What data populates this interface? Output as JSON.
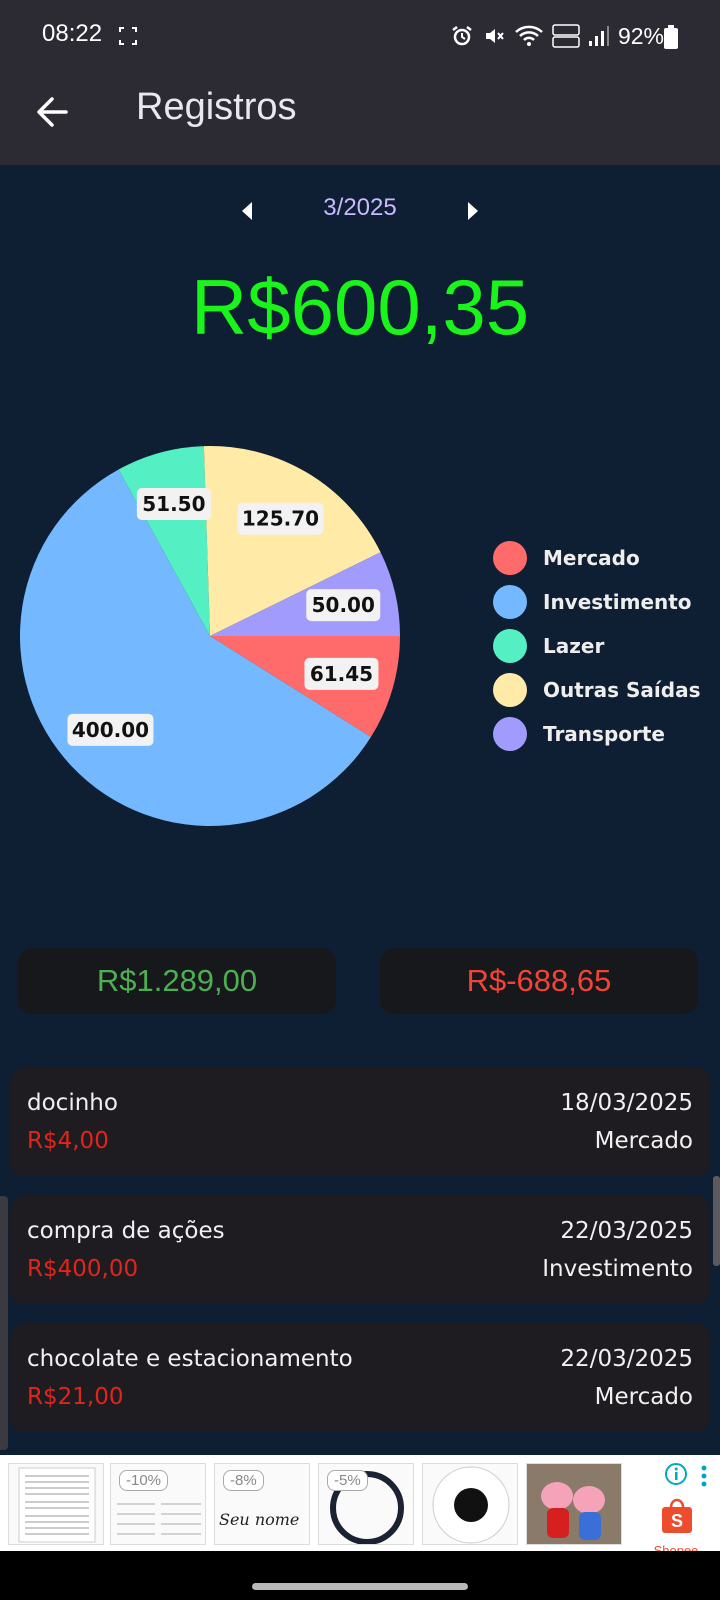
{
  "status_bar": {
    "time": "08:22",
    "battery_text": "92%",
    "icons": [
      "alarm-icon",
      "mute-icon",
      "wifi-icon",
      "volte-icon",
      "signal-icon",
      "battery-icon"
    ]
  },
  "app_bar": {
    "title": "Registros",
    "back_icon": "arrow-left-icon"
  },
  "month_nav": {
    "label": "3/2025",
    "prev_icon": "caret-left-icon",
    "next_icon": "caret-right-icon"
  },
  "balance": "R$600,35",
  "chart_data": {
    "type": "pie",
    "slices": [
      {
        "name": "Mercado",
        "value": 61.45,
        "label": "61.45",
        "color": "#ff6b6b"
      },
      {
        "name": "Investimento",
        "value": 400.0,
        "label": "400.00",
        "color": "#74b9ff"
      },
      {
        "name": "Lazer",
        "value": 51.5,
        "label": "51.50",
        "color": "#55efc4"
      },
      {
        "name": "Outras Saídas",
        "value": 125.7,
        "label": "125.70",
        "color": "#ffeaa7"
      },
      {
        "name": "Transporte",
        "value": 50.0,
        "label": "50.00",
        "color": "#a29bfe"
      }
    ],
    "legend_placement": "right"
  },
  "totals": {
    "income": "R$1.289,00",
    "expense": "R$-688,65"
  },
  "transactions": [
    {
      "description": "docinho",
      "amount": "R$4,00",
      "date": "18/03/2025",
      "category": "Mercado"
    },
    {
      "description": "compra de ações",
      "amount": "R$400,00",
      "date": "22/03/2025",
      "category": "Investimento"
    },
    {
      "description": "chocolate e estacionamento",
      "amount": "R$21,00",
      "date": "22/03/2025",
      "category": "Mercado"
    }
  ],
  "ad": {
    "badges": [
      "-10%",
      "-8%",
      "-5%"
    ],
    "script_text": "Seu nome",
    "brand": "Shopee"
  },
  "colors": {
    "background": "#0f1f33",
    "app_bar": "#2c2a33",
    "balance": "#19f51a",
    "income": "#4caf50",
    "expense": "#f44336",
    "amount": "#e0251a",
    "month_label": "#c9b8ff"
  }
}
